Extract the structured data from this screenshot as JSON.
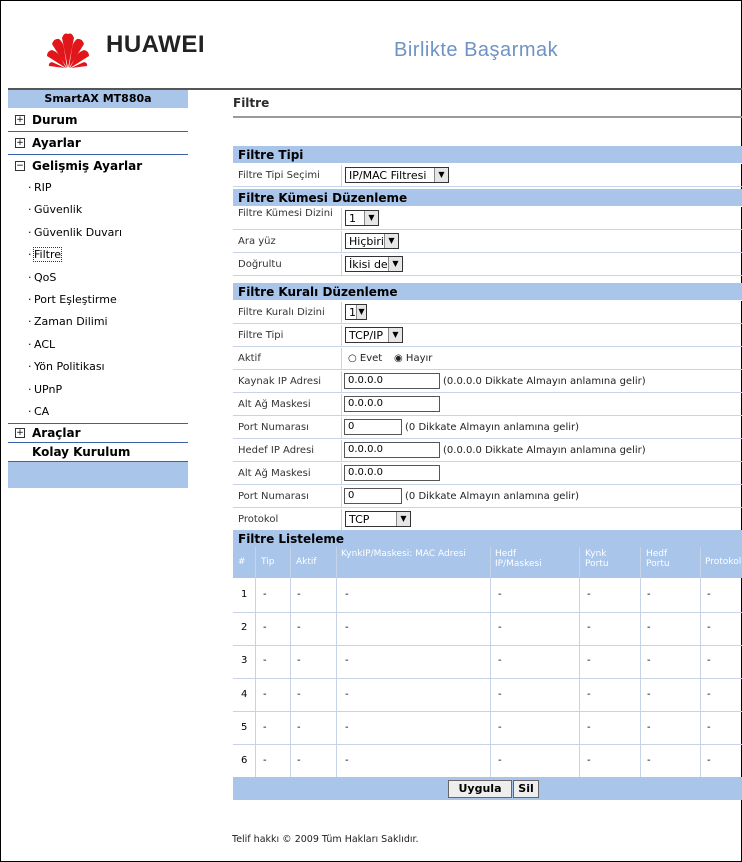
{
  "brand": {
    "name": "HUAWEI",
    "slogan": "Birlikte Başarmak",
    "logo_color": "#e0161a"
  },
  "sidebar": {
    "title": "SmartAX MT880a",
    "durum": "Durum",
    "ayarlar": "Ayarlar",
    "gelismis": "Gelişmiş Ayarlar",
    "sub": [
      "RIP",
      "Güvenlik",
      "Güvenlik Duvarı",
      "Filtre",
      "QoS",
      "Port Eşleştirme",
      "Zaman Dilimi",
      "ACL",
      "Yön Politikası",
      "UPnP",
      "CA"
    ],
    "araclar": "Araçlar",
    "kolay": "Kolay Kurulum"
  },
  "page_title": "Filtre",
  "filtre_tipi": {
    "header": "Filtre Tipi",
    "secimi_label": "Filtre Tipi Seçimi",
    "secimi_value": "IP/MAC Filtresi"
  },
  "kume": {
    "header": "Filtre Kümesi Düzenleme",
    "dizini_label": "Filtre Kümesi Dizini",
    "dizini_value": "1",
    "arayuz_label": "Ara yüz",
    "arayuz_value": "Hiçbiri",
    "dogrultu_label": "Doğrultu",
    "dogrultu_value": "İkisi de"
  },
  "kural": {
    "header": "Filtre Kuralı Düzenleme",
    "dizini_label": "Filtre Kuralı Dizini",
    "dizini_value": "1",
    "tip_label": "Filtre Tipi",
    "tip_value": "TCP/IP",
    "aktif_label": "Aktif",
    "evet": "Evet",
    "hayir": "Hayır",
    "kaynak_ip_label": "Kaynak IP Adresi",
    "kaynak_ip_value": "0.0.0.0",
    "ip_note": "(0.0.0.0 Dikkate Almayın anlamına gelir)",
    "mask1_label": "Alt Ağ Maskesi",
    "mask1_value": "0.0.0.0",
    "port1_label": "Port Numarası",
    "port1_value": "0",
    "port_note": "(0 Dikkate Almayın anlamına gelir)",
    "hedef_ip_label": "Hedef IP Adresi",
    "hedef_ip_value": "0.0.0.0",
    "mask2_label": "Alt Ağ Maskesi",
    "mask2_value": "0.0.0.0",
    "port2_label": "Port Numarası",
    "port2_value": "0",
    "protokol_label": "Protokol",
    "protokol_value": "TCP"
  },
  "liste": {
    "header": "Filtre Listeleme",
    "cols": [
      "#",
      "Tip",
      "Aktif",
      "KynkIP/Maskesi: MAC Adresi",
      "Hedf IP/Maskesi",
      "Kynk Portu",
      "Hedf Portu",
      "Protokol"
    ],
    "rows": [
      [
        "1",
        "-",
        "-",
        "-",
        "-",
        "-",
        "-",
        "-"
      ],
      [
        "2",
        "-",
        "-",
        "-",
        "-",
        "-",
        "-",
        "-"
      ],
      [
        "3",
        "-",
        "-",
        "-",
        "-",
        "-",
        "-",
        "-"
      ],
      [
        "4",
        "-",
        "-",
        "-",
        "-",
        "-",
        "-",
        "-"
      ],
      [
        "5",
        "-",
        "-",
        "-",
        "-",
        "-",
        "-",
        "-"
      ],
      [
        "6",
        "-",
        "-",
        "-",
        "-",
        "-",
        "-",
        "-"
      ]
    ]
  },
  "buttons": {
    "apply": "Uygula",
    "delete": "Sil"
  },
  "footer": "Telif hakkı © 2009 Tüm Hakları Saklıdır.",
  "colors": {
    "section_bg": "#a9c5ea",
    "slogan": "#6f93c4"
  }
}
